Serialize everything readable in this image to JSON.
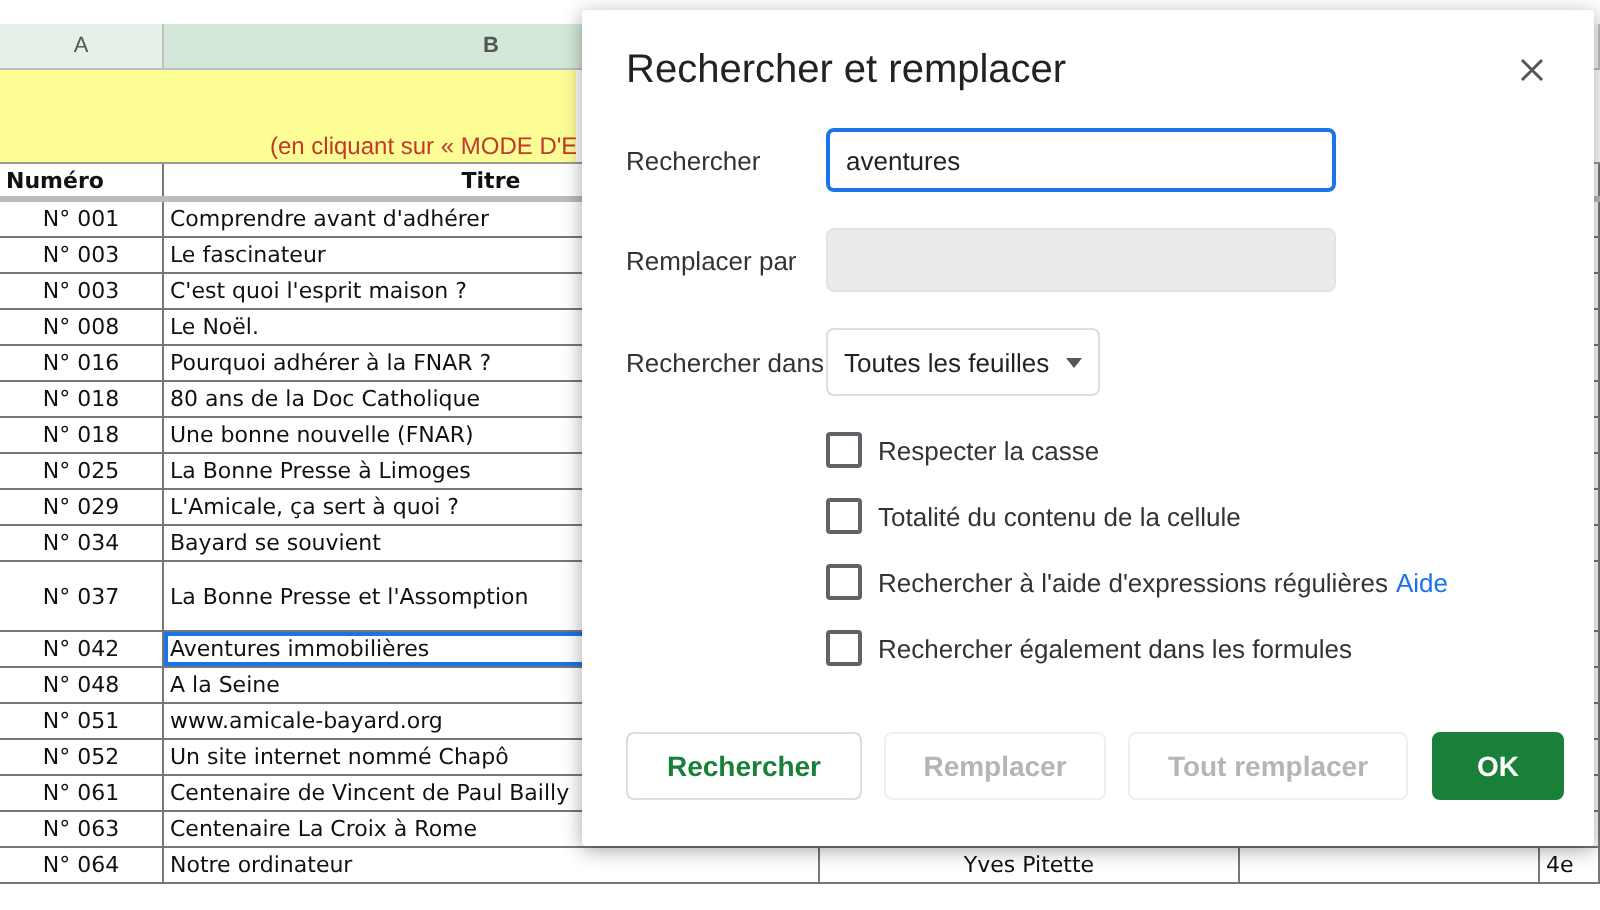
{
  "sheet": {
    "column_headers": [
      "A",
      "B"
    ],
    "banner": "(en cliquant sur « MODE D'E",
    "header": {
      "number": "Numéro",
      "title": "Titre"
    },
    "rows": [
      {
        "number": "N° 001",
        "title": "Comprendre avant d'adhérer",
        "selected": false
      },
      {
        "number": "N° 003",
        "title": "Le fascinateur",
        "selected": false
      },
      {
        "number": "N° 003",
        "title": "C'est quoi l'esprit maison ?",
        "selected": false
      },
      {
        "number": "N° 008",
        "title": "Le Noël.",
        "selected": false
      },
      {
        "number": "N° 016",
        "title": "Pourquoi adhérer à la FNAR ?",
        "selected": false
      },
      {
        "number": "N° 018",
        "title": "80 ans de la Doc Catholique",
        "selected": false
      },
      {
        "number": "N° 018",
        "title": "Une bonne nouvelle (FNAR)",
        "selected": false
      },
      {
        "number": "N° 025",
        "title": "La Bonne Presse à Limoges",
        "selected": false
      },
      {
        "number": "N° 029",
        "title": "L'Amicale, ça sert à quoi ?",
        "selected": false
      },
      {
        "number": "N° 034",
        "title": "Bayard se souvient",
        "selected": false
      },
      {
        "number": "N° 037",
        "title": "La Bonne Presse et l'Assomption",
        "selected": false,
        "tall": true
      },
      {
        "number": "N° 042",
        "title": "Aventures immobilières",
        "selected": true
      },
      {
        "number": "N° 048",
        "title": "A la Seine",
        "selected": false
      },
      {
        "number": "N° 051",
        "title": "www.amicale-bayard.org",
        "selected": false
      },
      {
        "number": "N° 052",
        "title": "Un site internet nommé Chapô",
        "selected": false
      },
      {
        "number": "N° 061",
        "title": "Centenaire de Vincent de Paul Bailly",
        "selected": false
      },
      {
        "number": "N° 063",
        "title": "Centenaire La Croix à Rome",
        "selected": false
      },
      {
        "number": "N° 064",
        "title": "Notre ordinateur",
        "column_3": "Yves Pitette",
        "column_5": "4e",
        "selected": false
      }
    ]
  },
  "dialog": {
    "title": "Rechercher et remplacer",
    "fields": [
      {
        "label": "Rechercher",
        "value": "aventures",
        "focused": true,
        "disabled": false
      },
      {
        "label": "Remplacer par",
        "focused": false,
        "disabled": true
      }
    ],
    "scope": {
      "label": "Rechercher dans",
      "value": "Toutes les feuilles"
    },
    "options": [
      {
        "label": "Respecter la casse",
        "checked": false
      },
      {
        "label": "Totalité du contenu de la cellule",
        "checked": false
      },
      {
        "label": "Rechercher à l'aide d'expressions régulières",
        "link": "Aide",
        "checked": false
      },
      {
        "label": "Rechercher également dans les formules",
        "checked": false
      }
    ],
    "buttons": [
      {
        "label": "Rechercher",
        "kind": "outline",
        "disabled": false
      },
      {
        "label": "Remplacer",
        "kind": "outline",
        "disabled": true
      },
      {
        "label": "Tout remplacer",
        "kind": "outline",
        "disabled": true
      },
      {
        "label": "OK",
        "kind": "primary",
        "disabled": false
      }
    ]
  }
}
